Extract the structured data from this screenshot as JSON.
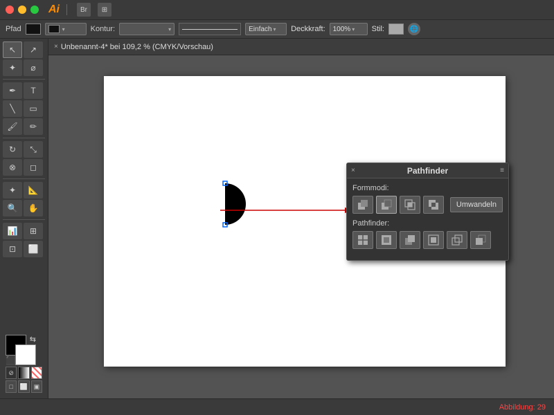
{
  "titlebar": {
    "app_name": "Ai",
    "icons": [
      "br-icon",
      "menu-icon"
    ]
  },
  "optionsbar": {
    "pfad_label": "Pfad",
    "kontur_label": "Kontur:",
    "einfach_label": "Einfach",
    "deckkraft_label": "Deckkraft:",
    "deckkraft_value": "100%",
    "stil_label": "Stil:"
  },
  "tab": {
    "close": "×",
    "label": "Unbenannt-4* bei 109,2 % (CMYK/Vorschau)"
  },
  "pathfinder": {
    "close": "×",
    "title": "Pathfinder",
    "menu": "≡",
    "formmodi_label": "Formmodi:",
    "pathfinder_label": "Pathfinder:",
    "umwandeln_label": "Umwandeln",
    "formmodi_buttons": [
      {
        "id": "unite",
        "tooltip": "Vereinen"
      },
      {
        "id": "minus-front",
        "tooltip": "Vorderste Form abziehen",
        "active": true
      },
      {
        "id": "intersect",
        "tooltip": "Schnittmenge"
      },
      {
        "id": "exclude",
        "tooltip": "Überlappungsbereich ausschließen"
      }
    ],
    "pathfinder_buttons": [
      {
        "id": "divide",
        "tooltip": "Teilen"
      },
      {
        "id": "trim",
        "tooltip": "Beschneiden"
      },
      {
        "id": "merge",
        "tooltip": "Zusammenfügen"
      },
      {
        "id": "crop",
        "tooltip": "Zuschneiden"
      },
      {
        "id": "outline",
        "tooltip": "Kontur"
      },
      {
        "id": "minus-back",
        "tooltip": "Hintere Form abziehen"
      }
    ]
  },
  "statusbar": {
    "text": "Abbildung: 29"
  },
  "tools": [
    [
      "cursor",
      "direct-select"
    ],
    [
      "magic-wand",
      "lasso"
    ],
    [
      "pen",
      "type"
    ],
    [
      "line",
      "rect"
    ],
    [
      "paintbrush",
      "pencil"
    ],
    [
      "rotate",
      "scale"
    ],
    [
      "blend",
      "eraser"
    ],
    [
      "eyedropper",
      "measure"
    ],
    [
      "zoom",
      "pan"
    ],
    [
      "graph",
      "mesh"
    ],
    [
      "slice",
      "artboard"
    ]
  ]
}
